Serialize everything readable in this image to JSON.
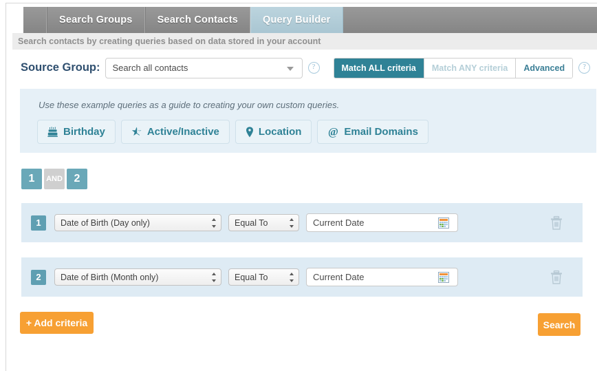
{
  "tabs": [
    {
      "label": "Search Groups",
      "active": false
    },
    {
      "label": "Search Contacts",
      "active": false
    },
    {
      "label": "Query Builder",
      "active": true
    }
  ],
  "subtitle": "Search contacts by creating queries based on data stored in your account",
  "source_group": {
    "label": "Source Group:",
    "value": "Search all contacts",
    "help": "?"
  },
  "match": {
    "all_label": "Match ALL criteria",
    "any_label": "Match ANY criteria",
    "advanced_label": "Advanced",
    "help": "?",
    "selected": "Match ALL criteria"
  },
  "examples": {
    "hint": "Use these example queries as a guide to creating your own custom queries.",
    "buttons": [
      {
        "label": "Birthday",
        "icon": "cake-icon"
      },
      {
        "label": "Active/Inactive",
        "icon": "star-icon"
      },
      {
        "label": "Location",
        "icon": "map-pin-icon"
      },
      {
        "label": "Email Domains",
        "icon": "at-icon"
      }
    ]
  },
  "query": {
    "badges": [
      {
        "label": "1",
        "type": "index"
      },
      {
        "label": "AND",
        "type": "operator"
      },
      {
        "label": "2",
        "type": "index"
      }
    ],
    "rows": [
      {
        "number": "1",
        "field": "Date of Birth (Day only)",
        "operator": "Equal To",
        "value": "Current Date"
      },
      {
        "number": "2",
        "field": "Date of Birth (Month only)",
        "operator": "Equal To",
        "value": "Current Date"
      }
    ]
  },
  "footer": {
    "add_criteria_label": "+ Add criteria",
    "search_label": "Search"
  },
  "colors": {
    "teal": "#2f8296",
    "orange": "#f7a033",
    "panel_blue": "#e6f0f7",
    "row_blue": "#deebf4",
    "tab_active": "#b2cdd8",
    "tab_bar": "#8f8f8f"
  }
}
